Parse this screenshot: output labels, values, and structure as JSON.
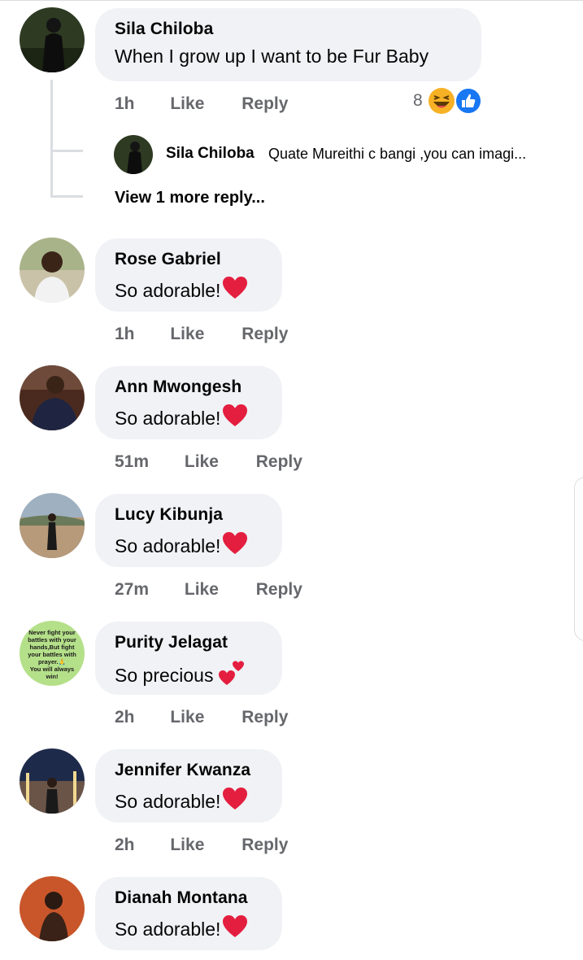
{
  "comments": [
    {
      "name": "Sila Chiloba",
      "text": "When I grow up I want to be Fur Baby",
      "time": "1h",
      "like": "Like",
      "reply": "Reply"
    },
    {
      "name": "Rose Gabriel",
      "text": "So adorable!",
      "time": "1h",
      "like": "Like",
      "reply": "Reply"
    },
    {
      "name": "Ann Mwongesh",
      "text": "So adorable!",
      "time": "51m",
      "like": "Like",
      "reply": "Reply"
    },
    {
      "name": "Lucy Kibunja",
      "text": "So adorable!",
      "time": "27m",
      "like": "Like",
      "reply": "Reply"
    },
    {
      "name": "Purity Jelagat",
      "text": "So precious ",
      "time": "2h",
      "like": "Like",
      "reply": "Reply"
    },
    {
      "name": "Jennifer Kwanza",
      "text": "So adorable!",
      "time": "2h",
      "like": "Like",
      "reply": "Reply"
    },
    {
      "name": "Dianah Montana",
      "text": "So adorable!"
    }
  ],
  "reactions": {
    "count": "8",
    "icons": [
      "haha-emoji-icon",
      "like-reaction-icon"
    ]
  },
  "reply_preview": {
    "name": "Sila Chiloba",
    "text": "Quate Mureithi c bangi ,you can imagi..."
  },
  "view_more": "View 1 more reply...",
  "avatar_poster_text": [
    "Never fight your",
    "battles with your",
    "hands,But fight",
    "your battles with",
    "prayer.🙏",
    "You will always",
    "win!"
  ],
  "colors": {
    "bubble": "#f0f2f5",
    "meta": "#65676b",
    "heart": "#e41e3f",
    "like_blue": "#1877f2",
    "haha_yellow": "#f7b125"
  }
}
